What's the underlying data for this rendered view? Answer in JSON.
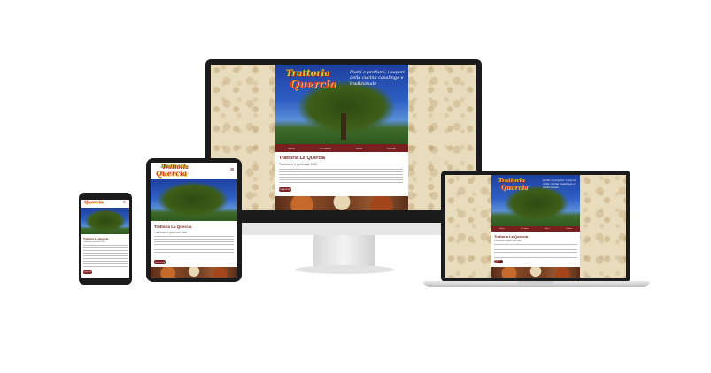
{
  "site": {
    "logo_line1": "Trattoria",
    "logo_line2": "Quercia",
    "tagline": "Piatti e profumi, i sapori della cucina casalinga e tradizionale",
    "title": "Trattoria La Quercia",
    "subtitle": "Tradizione e gusto dal 1960",
    "button_label": "Leggi di più",
    "nav_items": [
      "Home",
      "Chi siamo",
      "Menu",
      "Contatti"
    ]
  },
  "colors": {
    "brand": "#7a1f1f",
    "pattern": "#e9dcbc"
  },
  "icons": [
    "hamburger-menu-icon"
  ]
}
